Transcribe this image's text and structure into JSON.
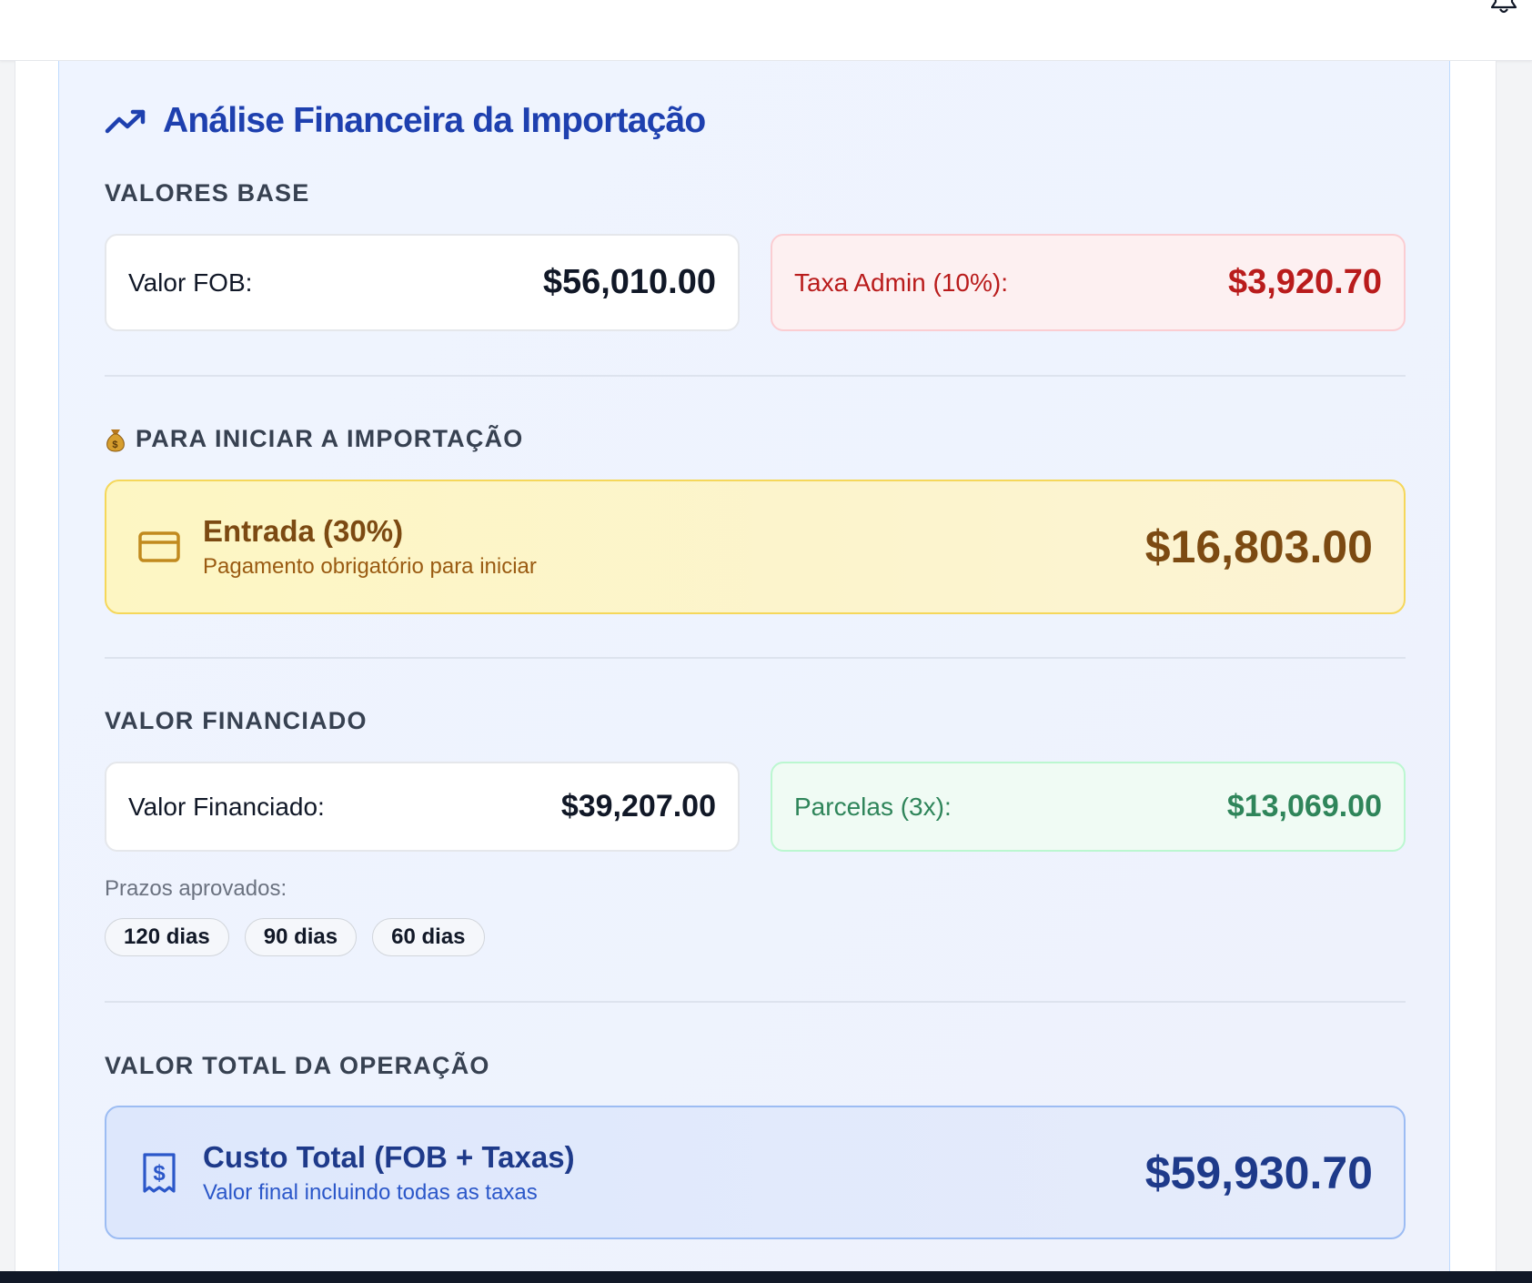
{
  "header": {
    "bell_icon": "bell-icon"
  },
  "panel": {
    "title": "Análise Financeira da Importação",
    "title_icon": "trending-up-icon",
    "base": {
      "heading": "VALORES BASE",
      "fob_label": "Valor FOB:",
      "fob_value": "$56,010.00",
      "admin_label": "Taxa Admin (10%):",
      "admin_value": "$3,920.70"
    },
    "start": {
      "heading": "PARA INICIAR A IMPORTAÇÃO",
      "heading_icon": "money-bag-icon",
      "card_icon": "credit-card-icon",
      "title": "Entrada (30%)",
      "subtitle": "Pagamento obrigatório para iniciar",
      "value": "$16,803.00"
    },
    "financed": {
      "heading": "VALOR FINANCIADO",
      "financed_label": "Valor Financiado:",
      "financed_value": "$39,207.00",
      "installments_label": "Parcelas (3x):",
      "installments_value": "$13,069.00",
      "terms_label": "Prazos aprovados:",
      "terms": [
        "120 dias",
        "90 dias",
        "60 dias"
      ]
    },
    "total": {
      "heading": "VALOR TOTAL DA OPERAÇÃO",
      "receipt_icon": "receipt-icon",
      "title": "Custo Total (FOB + Taxas)",
      "subtitle": "Valor final incluindo todas as taxas",
      "value": "$59,930.70"
    }
  },
  "colors": {
    "accent_blue": "#1e40af",
    "danger_red": "#b91c1c",
    "success_green": "#2f855a",
    "warning_brown": "#7c4a12"
  }
}
